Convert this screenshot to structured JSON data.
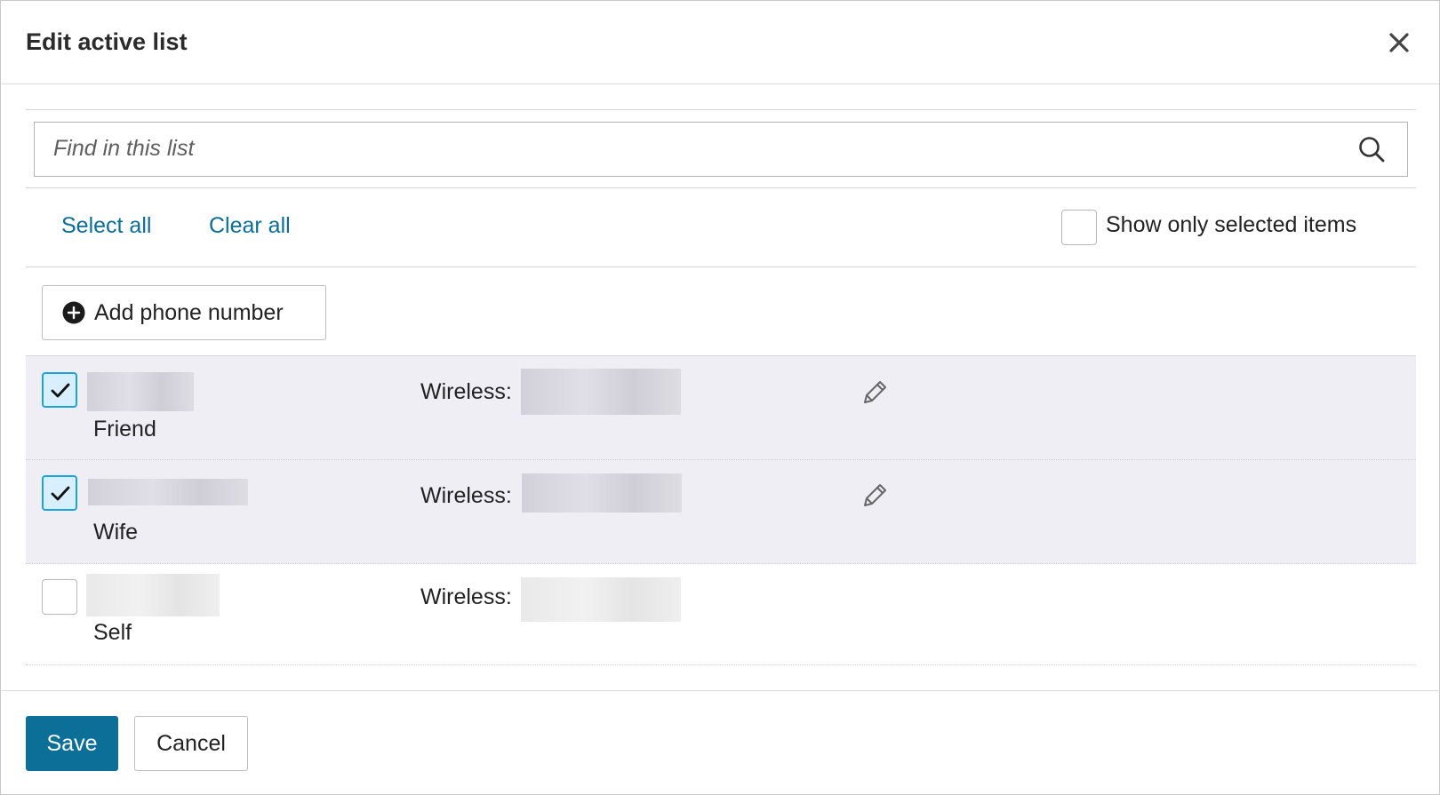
{
  "dialog": {
    "title": "Edit active list",
    "close_icon": "close-icon"
  },
  "search": {
    "placeholder": "Find in this list",
    "value": "",
    "icon": "search-icon"
  },
  "toolbar": {
    "select_all_label": "Select all",
    "clear_all_label": "Clear all",
    "show_only_selected_label": "Show only selected items",
    "show_only_selected_checked": false
  },
  "add_button": {
    "label": "Add phone number",
    "icon": "plus-circle-icon"
  },
  "contacts": [
    {
      "name": "",
      "tag": "Friend",
      "phone_label": "Wireless:",
      "phone": "",
      "selected": true,
      "editable": true
    },
    {
      "name": "",
      "tag": "Wife",
      "phone_label": "Wireless:",
      "phone": "",
      "selected": true,
      "editable": true
    },
    {
      "name": "",
      "tag": "Self",
      "phone_label": "Wireless:",
      "phone": "",
      "selected": false,
      "editable": false
    }
  ],
  "footer": {
    "save_label": "Save",
    "cancel_label": "Cancel"
  },
  "colors": {
    "link": "#0b6e9a",
    "primary_button": "#0c6f98",
    "selected_row": "#f0eef5",
    "checkbox_checked_border": "#1aa4dd",
    "checkbox_checked_fill": "#d8efff"
  }
}
